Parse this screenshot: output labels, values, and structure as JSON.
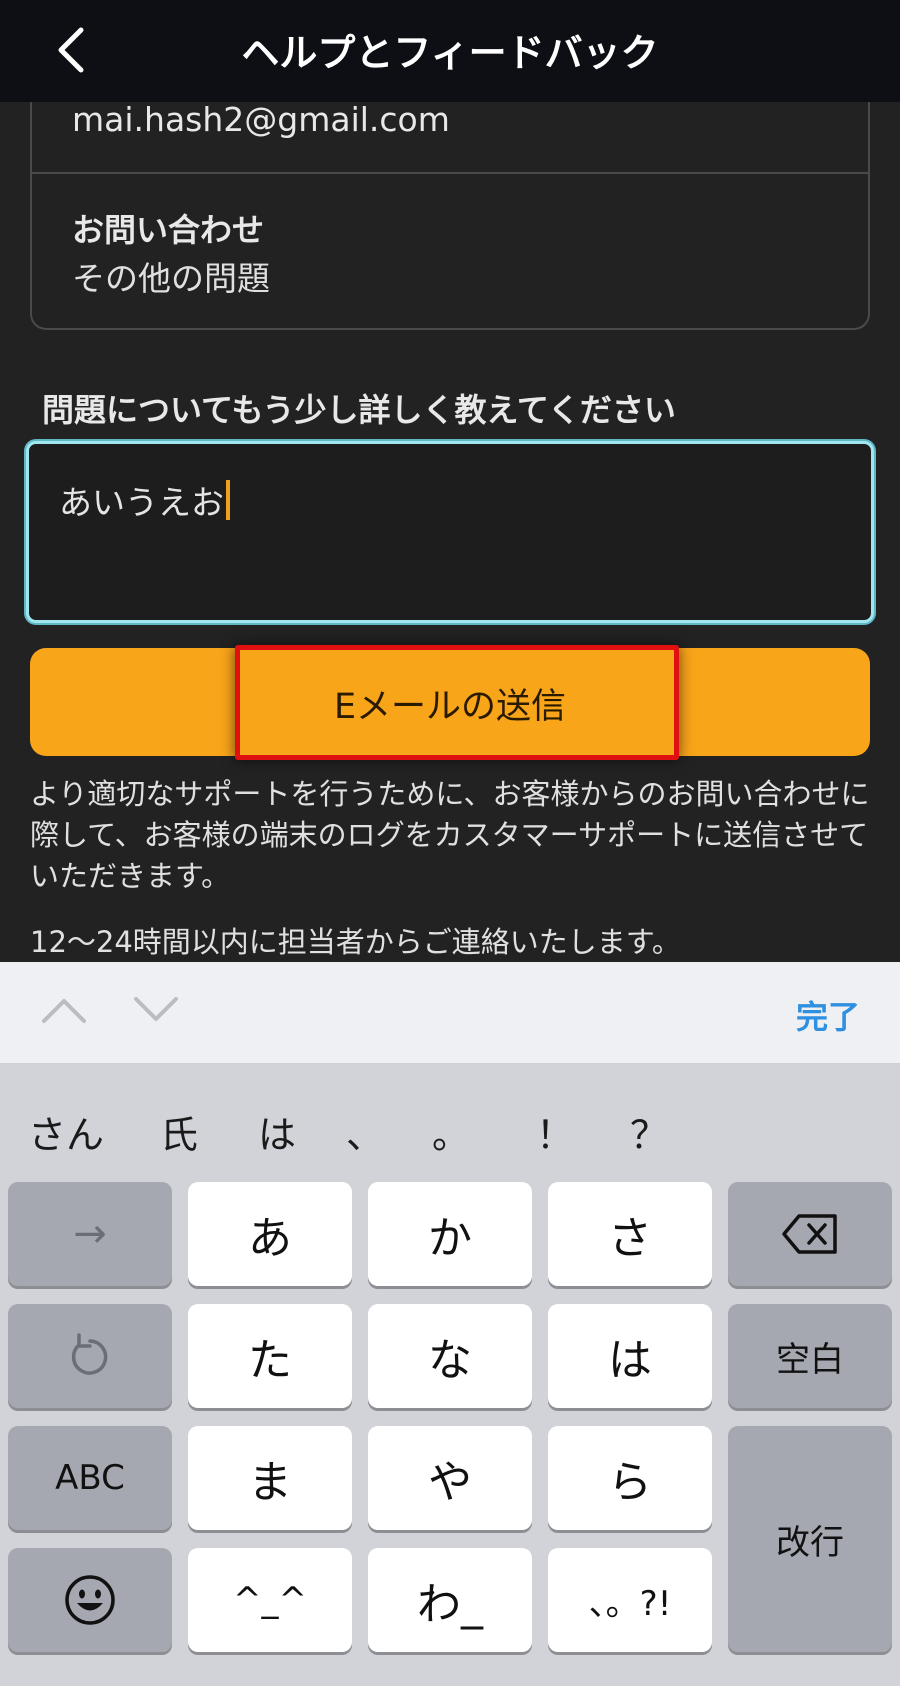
{
  "header": {
    "title": "ヘルプとフィードバック",
    "back_icon": "chevron-left-icon"
  },
  "card": {
    "email": "mai.hash2@gmail.com",
    "inquiry_label": "お問い合わせ",
    "inquiry_value": "その他の問題"
  },
  "form": {
    "label": "問題についてもう少し詳しく教えてください",
    "text_value": "あいうえお",
    "send_label": "Eメールの送信"
  },
  "notes": {
    "logs": "より適切なサポートを行うために、お客様からのお問い合わせに際して、お客様の端末のログをカスタマーサポートに送信させていただきます。",
    "response": "12〜24時間以内に担当者からご連絡いたします。"
  },
  "toolbar": {
    "done_label": "完了"
  },
  "keyboard": {
    "suggestions": [
      "さん",
      "氏",
      "は",
      "、",
      "。",
      "！",
      "？"
    ],
    "keys": {
      "a": "あ",
      "ka": "か",
      "sa": "さ",
      "ta": "た",
      "na": "な",
      "ha": "は",
      "ma": "ま",
      "ya": "や",
      "ra": "ら",
      "kaomoji": "^_^",
      "wa": "わ_",
      "punct": "、。?!",
      "space": "空白",
      "abc": "ABC",
      "enter": "改行",
      "arrow": "→"
    }
  },
  "colors": {
    "accent": "#f9a51a",
    "highlight": "#e01010",
    "focus": "#9fe6ef",
    "link": "#2f8fe0"
  }
}
